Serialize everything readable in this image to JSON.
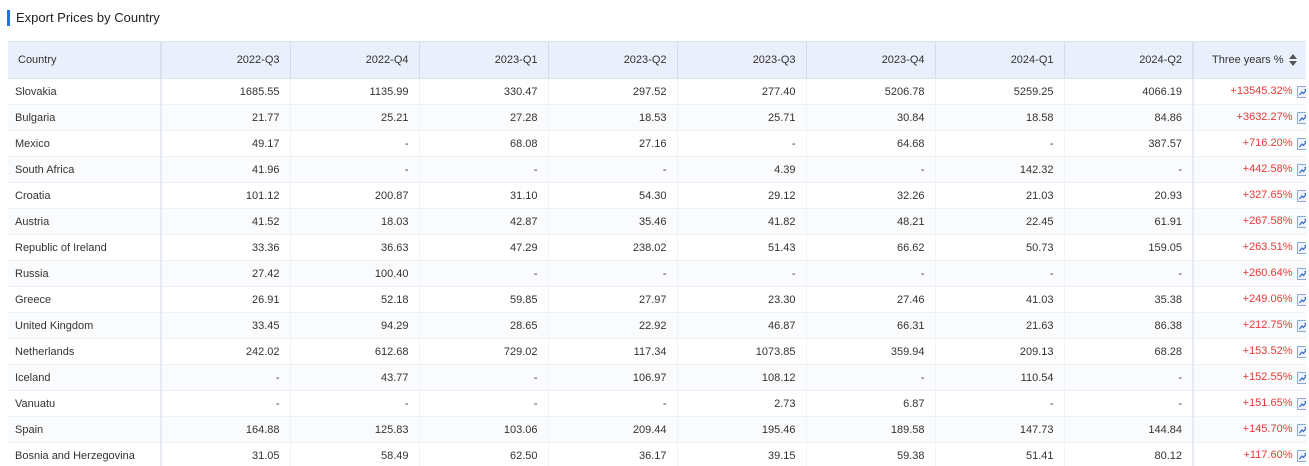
{
  "title": "Export Prices by Country",
  "colors": {
    "accent": "#1a73e8",
    "positive": "#e53935",
    "header_bg": "#e9effb"
  },
  "table": {
    "headers": [
      "Country",
      "2022-Q3",
      "2022-Q4",
      "2023-Q1",
      "2023-Q2",
      "2023-Q3",
      "2023-Q4",
      "2024-Q1",
      "2024-Q2",
      "Three years %"
    ],
    "rows": [
      [
        "Slovakia",
        "1685.55",
        "1135.99",
        "330.47",
        "297.52",
        "277.40",
        "5206.78",
        "5259.25",
        "4066.19",
        "+13545.32%"
      ],
      [
        "Bulgaria",
        "21.77",
        "25.21",
        "27.28",
        "18.53",
        "25.71",
        "30.84",
        "18.58",
        "84.86",
        "+3632.27%"
      ],
      [
        "Mexico",
        "49.17",
        "-",
        "68.08",
        "27.16",
        "-",
        "64.68",
        "-",
        "387.57",
        "+716.20%"
      ],
      [
        "South Africa",
        "41.96",
        "-",
        "-",
        "-",
        "4.39",
        "-",
        "142.32",
        "-",
        "+442.58%"
      ],
      [
        "Croatia",
        "101.12",
        "200.87",
        "31.10",
        "54.30",
        "29.12",
        "32.26",
        "21.03",
        "20.93",
        "+327.65%"
      ],
      [
        "Austria",
        "41.52",
        "18.03",
        "42.87",
        "35.46",
        "41.82",
        "48.21",
        "22.45",
        "61.91",
        "+267.58%"
      ],
      [
        "Republic of Ireland",
        "33.36",
        "36.63",
        "47.29",
        "238.02",
        "51.43",
        "66.62",
        "50.73",
        "159.05",
        "+263.51%"
      ],
      [
        "Russia",
        "27.42",
        "100.40",
        "-",
        "-",
        "-",
        "-",
        "-",
        "-",
        "+260.64%"
      ],
      [
        "Greece",
        "26.91",
        "52.18",
        "59.85",
        "27.97",
        "23.30",
        "27.46",
        "41.03",
        "35.38",
        "+249.06%"
      ],
      [
        "United Kingdom",
        "33.45",
        "94.29",
        "28.65",
        "22.92",
        "46.87",
        "66.31",
        "21.63",
        "86.38",
        "+212.75%"
      ],
      [
        "Netherlands",
        "242.02",
        "612.68",
        "729.02",
        "117.34",
        "1073.85",
        "359.94",
        "209.13",
        "68.28",
        "+153.52%"
      ],
      [
        "Iceland",
        "-",
        "43.77",
        "-",
        "106.97",
        "108.12",
        "-",
        "110.54",
        "-",
        "+152.55%"
      ],
      [
        "Vanuatu",
        "-",
        "-",
        "-",
        "-",
        "2.73",
        "6.87",
        "-",
        "-",
        "+151.65%"
      ],
      [
        "Spain",
        "164.88",
        "125.83",
        "103.06",
        "209.44",
        "195.46",
        "189.58",
        "147.73",
        "144.84",
        "+145.70%"
      ],
      [
        "Bosnia and Herzegovina",
        "31.05",
        "58.49",
        "62.50",
        "36.17",
        "39.15",
        "59.38",
        "51.41",
        "80.12",
        "+117.60%"
      ]
    ]
  },
  "icons": {
    "sort": "sort-icon",
    "trend": "trend-chart-icon"
  }
}
